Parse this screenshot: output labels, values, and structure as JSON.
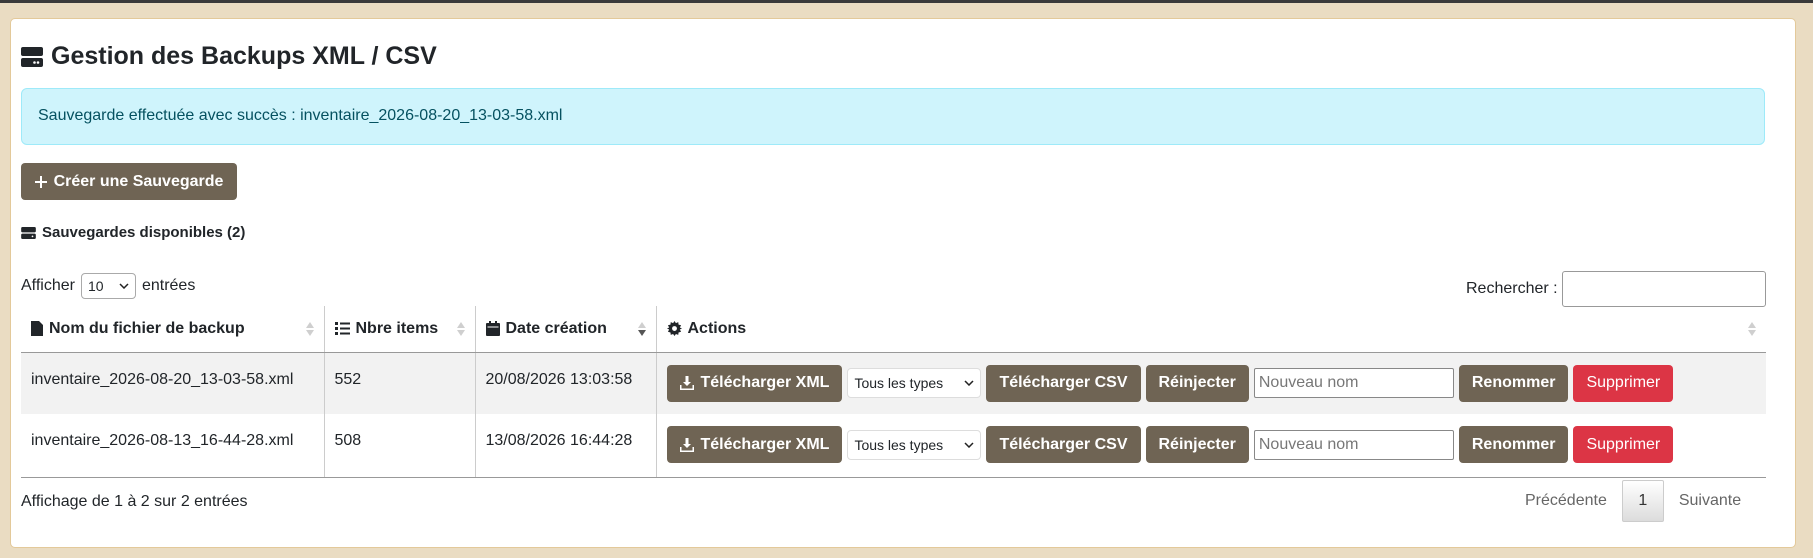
{
  "header": {
    "title": "Gestion des Backups XML / CSV",
    "icon": "server-icon"
  },
  "alert": {
    "message": "Sauvegarde effectuée avec succès : inventaire_2026-08-20_13-03-58.xml"
  },
  "create_button": {
    "label": "Créer une Sauvegarde",
    "icon": "plus-icon"
  },
  "section": {
    "title": "Sauvegardes disponibles (2)",
    "icon": "server-icon"
  },
  "length": {
    "prefix": "Afficher",
    "value": "10",
    "suffix": "entrées"
  },
  "search": {
    "label": "Rechercher :",
    "value": ""
  },
  "table": {
    "columns": [
      {
        "label": "Nom du fichier de backup",
        "icon": "file-icon"
      },
      {
        "label": "Nbre items",
        "icon": "list-icon"
      },
      {
        "label": "Date création",
        "icon": "calendar-icon"
      },
      {
        "label": "Actions",
        "icon": "gear-icon"
      }
    ],
    "rows": [
      {
        "file": "inventaire_2026-08-20_13-03-58.xml",
        "items": "552",
        "date": "20/08/2026 13:03:58"
      },
      {
        "file": "inventaire_2026-08-13_16-44-28.xml",
        "items": "508",
        "date": "13/08/2026 16:44:28"
      }
    ],
    "actions": {
      "download_xml": "Télécharger XML",
      "type_select": "Tous les types",
      "download_csv": "Télécharger CSV",
      "reinject": "Réinjecter",
      "rename_placeholder": "Nouveau nom",
      "rename": "Renommer",
      "delete": "Supprimer"
    }
  },
  "footer": {
    "info": "Affichage de 1 à 2 sur 2 entrées",
    "prev": "Précédente",
    "page": "1",
    "next": "Suivante"
  },
  "colors": {
    "primary_btn": "#6f6454",
    "danger": "#dc3545",
    "alert_bg": "#cff4fc",
    "page_bg": "#eadcc2"
  }
}
